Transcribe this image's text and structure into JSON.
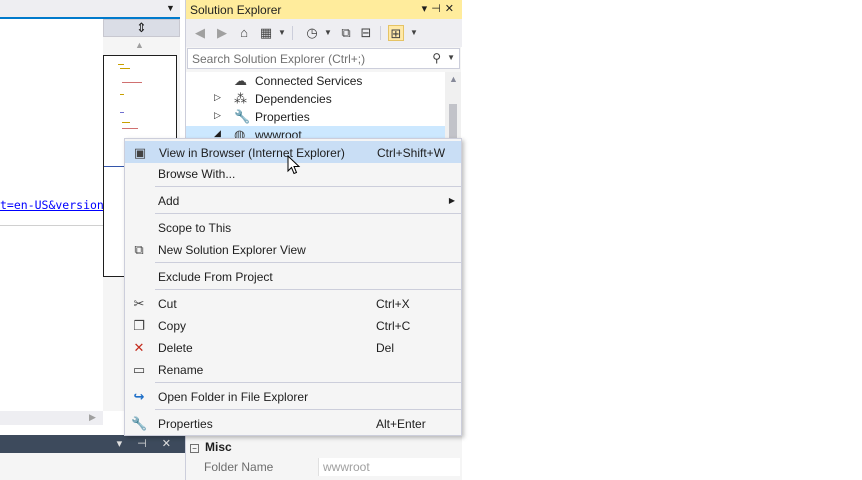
{
  "solution_explorer": {
    "title": "Solution Explorer",
    "search_placeholder": "Search Solution Explorer (Ctrl+;)",
    "tree": [
      {
        "label": "Connected Services",
        "icon": "cloud-icon",
        "expandable": false
      },
      {
        "label": "Dependencies",
        "icon": "dependencies-icon",
        "expandable": true
      },
      {
        "label": "Properties",
        "icon": "wrench-icon",
        "expandable": true
      },
      {
        "label": "wwwroot",
        "icon": "globe-icon",
        "expandable": true,
        "selected": true
      }
    ]
  },
  "editor": {
    "link_text": "t=en-US&version"
  },
  "context_menu": {
    "items": [
      {
        "label": "View in Browser (Internet Explorer)",
        "shortcut": "Ctrl+Shift+W",
        "icon": "browser-icon",
        "highlighted": true
      },
      {
        "label": "Browse With...",
        "shortcut": "",
        "icon": ""
      },
      {
        "label": "Add",
        "shortcut": "",
        "icon": "",
        "submenu": true
      },
      {
        "label": "Scope to This",
        "shortcut": "",
        "icon": ""
      },
      {
        "label": "New Solution Explorer View",
        "shortcut": "",
        "icon": "new-view-icon"
      },
      {
        "label": "Exclude From Project",
        "shortcut": "",
        "icon": ""
      },
      {
        "label": "Cut",
        "shortcut": "Ctrl+X",
        "icon": "scissors-icon"
      },
      {
        "label": "Copy",
        "shortcut": "Ctrl+C",
        "icon": "copy-icon"
      },
      {
        "label": "Delete",
        "shortcut": "Del",
        "icon": "delete-x-icon"
      },
      {
        "label": "Rename",
        "shortcut": "",
        "icon": "rename-icon"
      },
      {
        "label": "Open Folder in File Explorer",
        "shortcut": "",
        "icon": "open-folder-icon"
      },
      {
        "label": "Properties",
        "shortcut": "Alt+Enter",
        "icon": "wrench-icon"
      }
    ]
  },
  "properties": {
    "section": "Misc",
    "rows": [
      {
        "name": "Folder Name",
        "value": "wwwroot"
      }
    ]
  },
  "colors": {
    "accent": "#007acc",
    "title_active": "#ffec9c",
    "menu_highlight": "#c9def5",
    "delete_red": "#c42b1c",
    "link_blue": "#0000ff"
  }
}
